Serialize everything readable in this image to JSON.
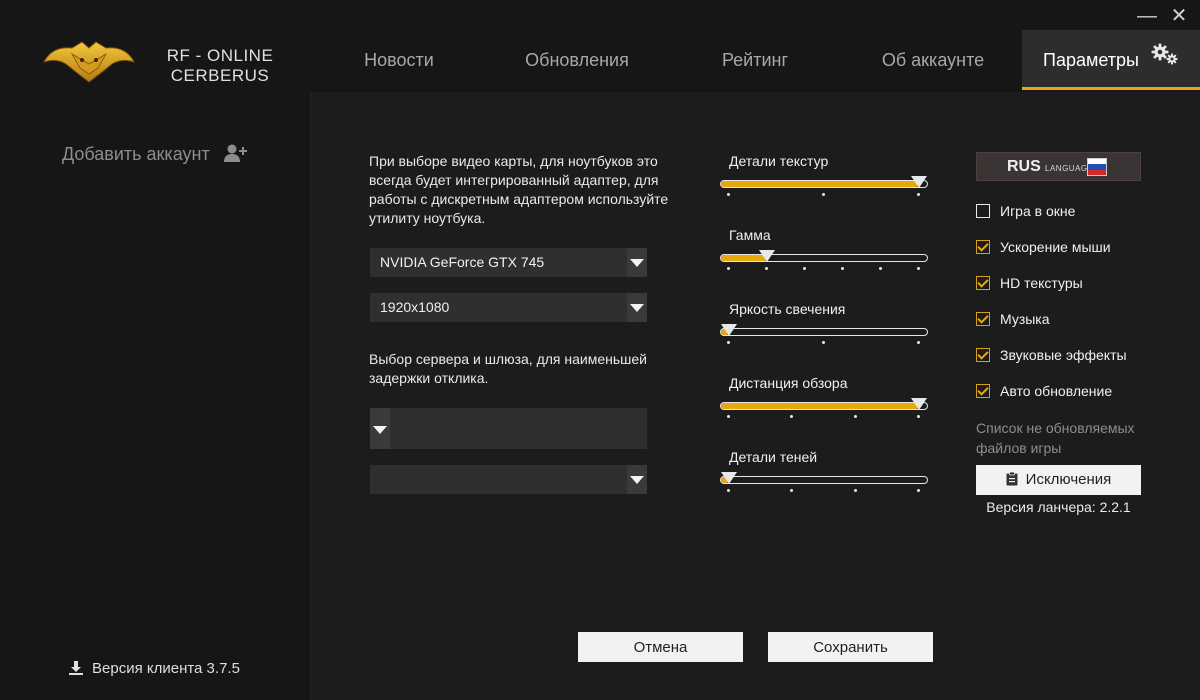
{
  "window": {
    "minimize_label": "—",
    "close_label": "✕"
  },
  "logo": {
    "line1": "RF - ONLINE",
    "line2": "CERBERUS"
  },
  "tabs": [
    {
      "label": "Новости"
    },
    {
      "label": "Обновления"
    },
    {
      "label": "Рейтинг"
    },
    {
      "label": "Об аккаунте"
    },
    {
      "label": "Параметры",
      "active": true
    }
  ],
  "sidebar": {
    "add_account_label": "Добавить аккаунт",
    "client_version": "Версия клиента 3.7.5"
  },
  "video": {
    "description": "При выборе видео карты, для ноутбуков это всегда будет интегрированный адаптер, для работы с дискретным адаптером используйте утилиту ноутбука.",
    "gpu_value": "NVIDIA GeForce GTX 745",
    "resolution_value": "1920x1080"
  },
  "server": {
    "description": "Выбор сервера и шлюза, для наименьшей задержки отклика.",
    "server_value": "",
    "gateway_value": ""
  },
  "sliders": [
    {
      "label": "Детали текстур",
      "value": 1.0,
      "ticks": 3
    },
    {
      "label": "Гамма",
      "value": 0.2,
      "ticks": 6
    },
    {
      "label": "Яркость свечения",
      "value": 0.0,
      "ticks": 3
    },
    {
      "label": "Дистанция обзора",
      "value": 1.0,
      "ticks": 4
    },
    {
      "label": "Детали теней",
      "value": 0.0,
      "ticks": 4
    }
  ],
  "language": {
    "code": "RUS",
    "caption": "LANGUAGE"
  },
  "options": [
    {
      "label": "Игра в окне",
      "checked": false
    },
    {
      "label": "Ускорение мыши",
      "checked": true
    },
    {
      "label": "HD текстуры",
      "checked": true
    },
    {
      "label": "Музыка",
      "checked": true
    },
    {
      "label": "Звуковые эффекты",
      "checked": true
    },
    {
      "label": "Авто обновление",
      "checked": true
    }
  ],
  "exclusions": {
    "note": "Список не обновляемых файлов игры",
    "button_label": "Исключения"
  },
  "launcher_version": "Версия ланчера: 2.2.1",
  "actions": {
    "cancel_label": "Отмена",
    "save_label": "Сохранить"
  },
  "colors": {
    "accent": "#e6a90c",
    "panel": "#1c1c1c",
    "background": "#161616"
  }
}
